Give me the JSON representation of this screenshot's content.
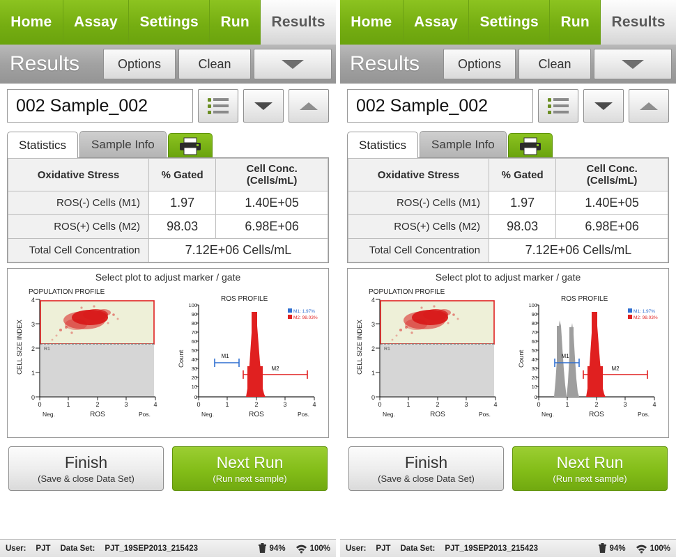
{
  "nav": {
    "items": [
      {
        "label": "Home",
        "active": false
      },
      {
        "label": "Assay",
        "active": false
      },
      {
        "label": "Settings",
        "active": false
      },
      {
        "label": "Run",
        "active": false
      },
      {
        "label": "Results",
        "active": true
      }
    ]
  },
  "titlebar": {
    "title": "Results",
    "options_label": "Options",
    "clean_label": "Clean",
    "menu_icon": "chevron-down-icon"
  },
  "sample": {
    "value": "002 Sample_002",
    "list_icon": "list-view-icon",
    "down_icon": "caret-down-icon",
    "up_icon": "caret-up-icon"
  },
  "tabs": {
    "statistics": "Statistics",
    "sample_info": "Sample Info",
    "print_icon": "printer-icon"
  },
  "stats_table": {
    "headers": [
      "Oxidative Stress",
      "% Gated",
      "Cell Conc. (Cells/mL)"
    ],
    "rows": [
      {
        "label": "ROS(-) Cells (M1)",
        "gated": "1.97",
        "conc": "1.40E+05"
      },
      {
        "label": "ROS(+) Cells (M2)",
        "gated": "98.03",
        "conc": "6.98E+06"
      }
    ],
    "total_label": "Total Cell Concentration",
    "total_value": "7.12E+06 Cells/mL"
  },
  "plots": {
    "hint": "Select plot to adjust marker / gate",
    "scatter": {
      "title": "POPULATION PROFILE",
      "ylabel": "CELL SIZE INDEX",
      "xlabel": "ROS",
      "x_ticks": [
        "0",
        "1",
        "2",
        "3",
        "4"
      ],
      "y_ticks": [
        "0",
        "1",
        "2",
        "3",
        "4"
      ],
      "x_left_note": "Neg.",
      "x_right_note": "Pos.",
      "gate_label": "R1"
    },
    "histogram": {
      "title": "ROS PROFILE",
      "ylabel": "Count",
      "xlabel": "ROS",
      "x_ticks": [
        "0",
        "1",
        "2",
        "3",
        "4"
      ],
      "y_ticks": [
        "100",
        "90",
        "80",
        "70",
        "60",
        "50",
        "40",
        "30",
        "20",
        "10",
        "0"
      ],
      "x_left_note": "Neg.",
      "x_right_note": "Pos.",
      "marker_m1": "M1",
      "marker_m2": "M2",
      "legend_m1": "M1: 1.97%",
      "legend_m2": "M2: 98.03%"
    }
  },
  "bottom": {
    "finish_title": "Finish",
    "finish_sub": "(Save & close Data Set)",
    "next_title": "Next Run",
    "next_sub": "(Run next sample)"
  },
  "status": {
    "user_label": "User:",
    "user_value": "PJT",
    "dataset_label": "Data Set:",
    "dataset_value": "PJT_19SEP2013_215423",
    "waste_icon": "trash-icon",
    "waste_value": "94%",
    "signal_icon": "wifi-icon",
    "signal_value": "100%"
  },
  "colors": {
    "nav_green": "#7ab317",
    "title_gray": "#a2a2a2",
    "plot_red": "#e02020",
    "gate_fill": "#eef0d8"
  }
}
